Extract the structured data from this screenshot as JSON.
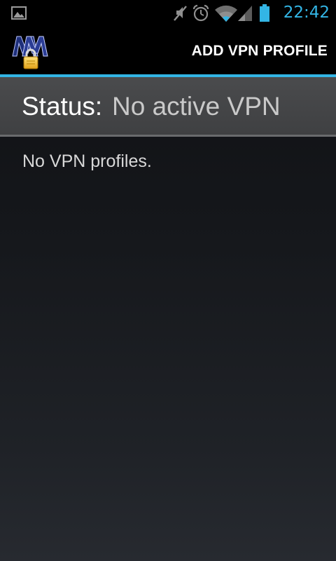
{
  "status_bar": {
    "time": "22:42",
    "icons": [
      "picture-notification-icon",
      "mute-icon",
      "alarm-icon",
      "wifi-icon",
      "signal-icon",
      "battery-icon"
    ]
  },
  "action_bar": {
    "logo": "vpn-app-logo",
    "action_label": "ADD VPN PROFILE"
  },
  "status_panel": {
    "label": "Status:",
    "value": "No active VPN"
  },
  "profiles": {
    "empty_text": "No VPN profiles."
  },
  "colors": {
    "accent": "#33b5e5",
    "background": "#15171b",
    "panel": "#444547"
  }
}
